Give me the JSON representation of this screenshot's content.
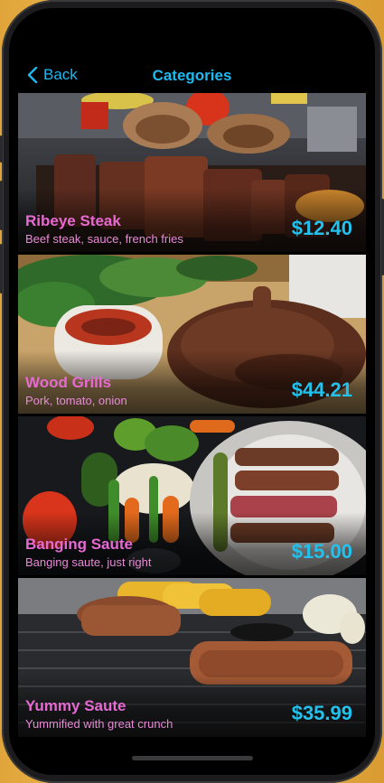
{
  "nav": {
    "back_label": "Back",
    "title": "Categories"
  },
  "items": [
    {
      "name": "Ribeye Steak",
      "description": "Beef steak, sauce, french fries",
      "price": "$12.40"
    },
    {
      "name": "Wood Grills",
      "description": "Pork, tomato, onion",
      "price": "$44.21"
    },
    {
      "name": "Banging Saute",
      "description": "Banging saute, just right",
      "price": "$15.00"
    },
    {
      "name": "Yummy Saute",
      "description": "Yummified with great crunch",
      "price": "$35.99"
    }
  ],
  "colors": {
    "accent": "#1fb8f0",
    "item_name": "#e66ad2",
    "price": "#21c2ee"
  }
}
